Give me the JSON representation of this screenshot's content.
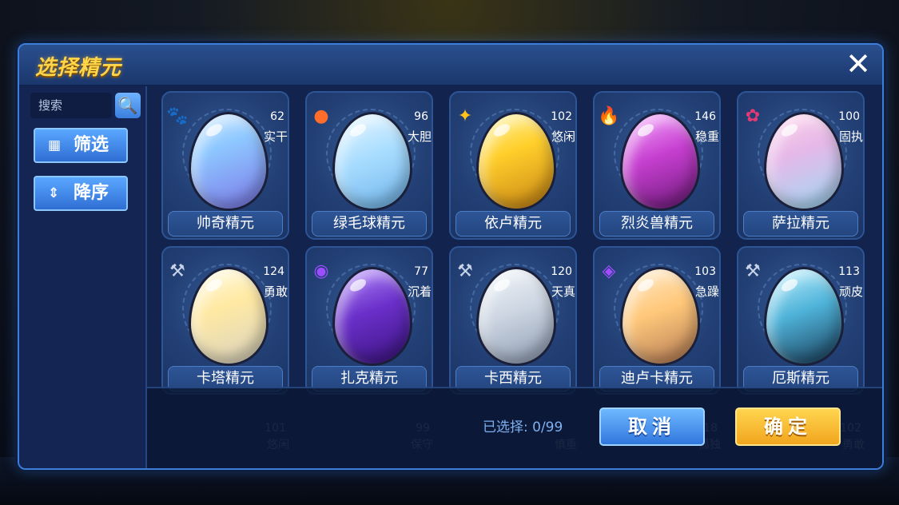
{
  "header": {
    "title": "选择精元",
    "close_icon": "✕"
  },
  "sidebar": {
    "search_placeholder": "搜索",
    "search_icon": "search-icon",
    "filter_label": "筛选",
    "filter_icon": "grid-icon",
    "sort_label": "降序",
    "sort_icon": "sort-icon"
  },
  "cards": [
    {
      "name": "帅奇精元",
      "level": "62",
      "nature": "实干",
      "icon": "🐾",
      "icon_color": "#e53935",
      "egg": "linear-gradient(160deg,#cfe9ff 0%,#8ec8ff 35%,#7b78e8 100%)"
    },
    {
      "name": "绿毛球精元",
      "level": "96",
      "nature": "大胆",
      "icon": "●",
      "icon_color": "#ff6d2b",
      "egg": "linear-gradient(160deg,#e8f7ff 0%,#a9ddff 45%,#6fb4ea 100%)"
    },
    {
      "name": "依卢精元",
      "level": "102",
      "nature": "悠闲",
      "icon": "✦",
      "icon_color": "#ffc21a",
      "egg": "linear-gradient(160deg,#fff3a0 0%,#ffcf2b 40%,#c88414 100%)"
    },
    {
      "name": "烈炎兽精元",
      "level": "146",
      "nature": "稳重",
      "icon": "🔥",
      "icon_color": "#ff6a1a",
      "egg": "linear-gradient(160deg,#f7a8ff 0%,#c63fd0 45%,#6e1a7a 100%)"
    },
    {
      "name": "萨拉精元",
      "level": "100",
      "nature": "固执",
      "icon": "✿",
      "icon_color": "#e53975",
      "egg": "linear-gradient(160deg,#ffd3ea 0%,#e6b8e8 40%,#9fd9f5 100%)"
    },
    {
      "name": "卡塔精元",
      "level": "124",
      "nature": "勇敢",
      "icon": "⚒",
      "icon_color": "#c7d3e8",
      "egg": "linear-gradient(160deg,#fffbe0 0%,#ffe9a3 40%,#d9d3c0 100%)"
    },
    {
      "name": "扎克精元",
      "level": "77",
      "nature": "沉着",
      "icon": "◉",
      "icon_color": "#9c4dff",
      "egg": "linear-gradient(160deg,#b48cff 0%,#6a2fc9 45%,#3c1480 100%)"
    },
    {
      "name": "卡西精元",
      "level": "120",
      "nature": "天真",
      "icon": "⚒",
      "icon_color": "#c7d3e8",
      "egg": "linear-gradient(160deg,#f2f6fb 0%,#cdd6e2 45%,#8d9bb1 100%)"
    },
    {
      "name": "迪卢卡精元",
      "level": "103",
      "nature": "急躁",
      "icon": "◈",
      "icon_color": "#a24dff",
      "egg": "linear-gradient(160deg,#ffe9c8 0%,#ffc87a 45%,#b47a55 100%)"
    },
    {
      "name": "厄斯精元",
      "level": "113",
      "nature": "顽皮",
      "icon": "⚒",
      "icon_color": "#c7d3e8",
      "egg": "linear-gradient(160deg,#bff2ff 0%,#4fb3d9 45%,#1a3d5a 100%)"
    }
  ],
  "ghost_row": [
    {
      "level": "101",
      "nature": "悠闲"
    },
    {
      "level": "99",
      "nature": "保守"
    },
    {
      "level": "",
      "nature": "慎重"
    },
    {
      "level": "118",
      "nature": "孤独"
    },
    {
      "level": "102",
      "nature": "勇敢"
    }
  ],
  "footer": {
    "selected": "已选择: 0/99",
    "cancel_label": "取消",
    "confirm_label": "确定"
  }
}
